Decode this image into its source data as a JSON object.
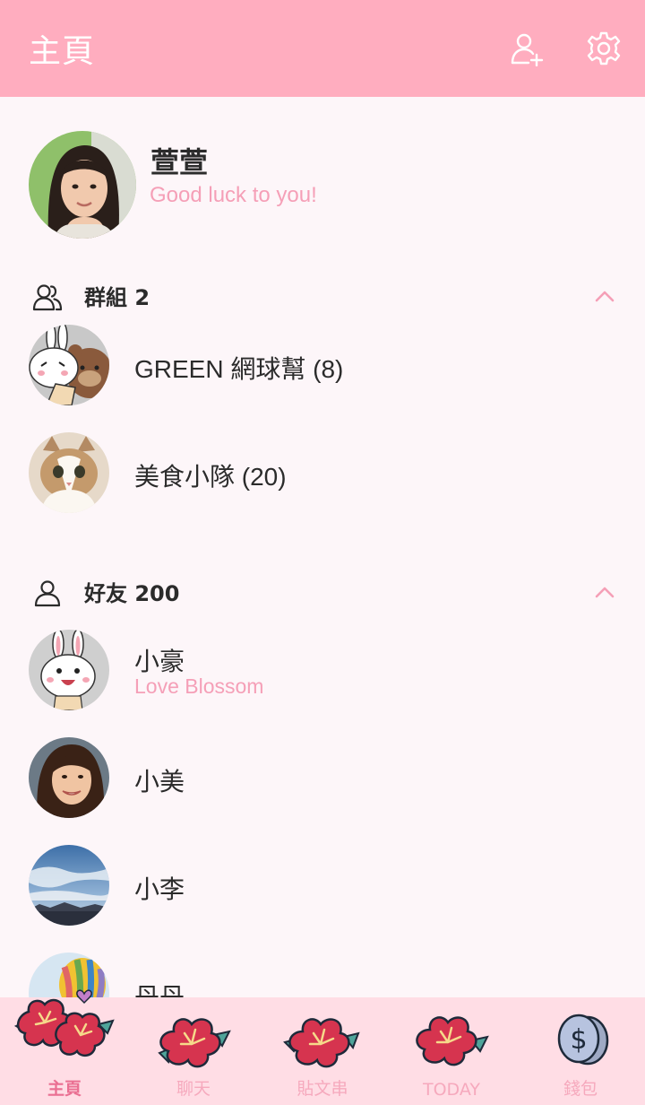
{
  "header": {
    "title": "主頁",
    "icons": [
      "add-friend-icon",
      "settings-gear-icon"
    ]
  },
  "profile": {
    "name": "萱萱",
    "status": "Good luck to you!"
  },
  "groups": {
    "label": "群組 2",
    "items": [
      {
        "name": "GREEN 網球幫 (8)",
        "avatar": "bunny-and-bear-avatar"
      },
      {
        "name": "美食小隊 (20)",
        "avatar": "cat-avatar"
      }
    ]
  },
  "friends": {
    "label": "好友 200",
    "items": [
      {
        "name": "小豪",
        "status": "Love Blossom",
        "avatar": "bunny-avatar"
      },
      {
        "name": "小美",
        "avatar": "woman-photo-avatar"
      },
      {
        "name": "小李",
        "avatar": "sky-photo-avatar"
      },
      {
        "name": "丹丹",
        "avatar": "balloon-photo-avatar"
      }
    ]
  },
  "tabbar": {
    "items": [
      {
        "label": "主頁",
        "active": true
      },
      {
        "label": "聊天",
        "active": false
      },
      {
        "label": "貼文串",
        "active": false
      },
      {
        "label": "TODAY",
        "active": false
      },
      {
        "label": "錢包",
        "active": false
      }
    ]
  },
  "colors": {
    "header_bg": "#ffadbf",
    "background": "#fdf6f9",
    "accent_text": "#f59fb7",
    "tabbar_bg": "#ffdde5",
    "flower_red": "#d6344f"
  }
}
